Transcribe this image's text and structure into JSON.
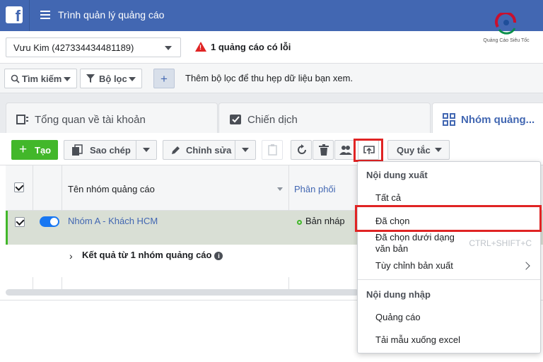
{
  "topbar": {
    "logo_letter": "f",
    "title": "Trình quản lý quảng cáo"
  },
  "brand": {
    "name": "Quảng Cáo Siêu Tốc",
    "colors": [
      "#c8102e",
      "#0a8f4b",
      "#1f4e9a"
    ]
  },
  "account": {
    "selected": "Vưu Kim (427334434481189)",
    "error_text": "1 quảng cáo có lỗi"
  },
  "filters": {
    "search_label": "Tìm kiếm",
    "filter_label": "Bộ lọc",
    "plus_label": "+",
    "hint": "Thêm bộ lọc để thu hẹp dữ liệu bạn xem."
  },
  "tabs": [
    {
      "label": "Tổng quan về tài khoản"
    },
    {
      "label": "Chiến dịch"
    },
    {
      "label": "Nhóm quảng..."
    }
  ],
  "toolbar": {
    "create_label": "Tạo",
    "copy_label": "Sao chép",
    "edit_label": "Chỉnh sửa",
    "rules_label": "Quy tắc"
  },
  "table": {
    "headers": {
      "name": "Tên nhóm quảng cáo",
      "delivery": "Phân phối"
    },
    "rows": [
      {
        "name": "Nhóm A - Khách HCM",
        "status": "Bản nháp",
        "active": true
      }
    ],
    "summary": "Kết quả từ 1 nhóm quảng cáo"
  },
  "export_menu": {
    "export_section": "Nội dung xuất",
    "items": [
      {
        "label": "Tất cả"
      },
      {
        "label": "Đã chọn"
      },
      {
        "label": "Đã chọn dưới dạng văn bản",
        "line1": "Đã chọn dưới dạng",
        "line2": "văn bản",
        "shortcut": "CTRL+SHIFT+C"
      },
      {
        "label": "Tùy chỉnh bản xuất"
      }
    ],
    "import_section": "Nội dung nhập",
    "import_items": [
      {
        "label": "Quảng cáo"
      },
      {
        "label": "Tải mẫu xuống excel"
      }
    ]
  },
  "colors": {
    "topbar": "#4267b2",
    "create": "#42b72a",
    "highlight": "#e02424",
    "link": "#4267b2"
  }
}
